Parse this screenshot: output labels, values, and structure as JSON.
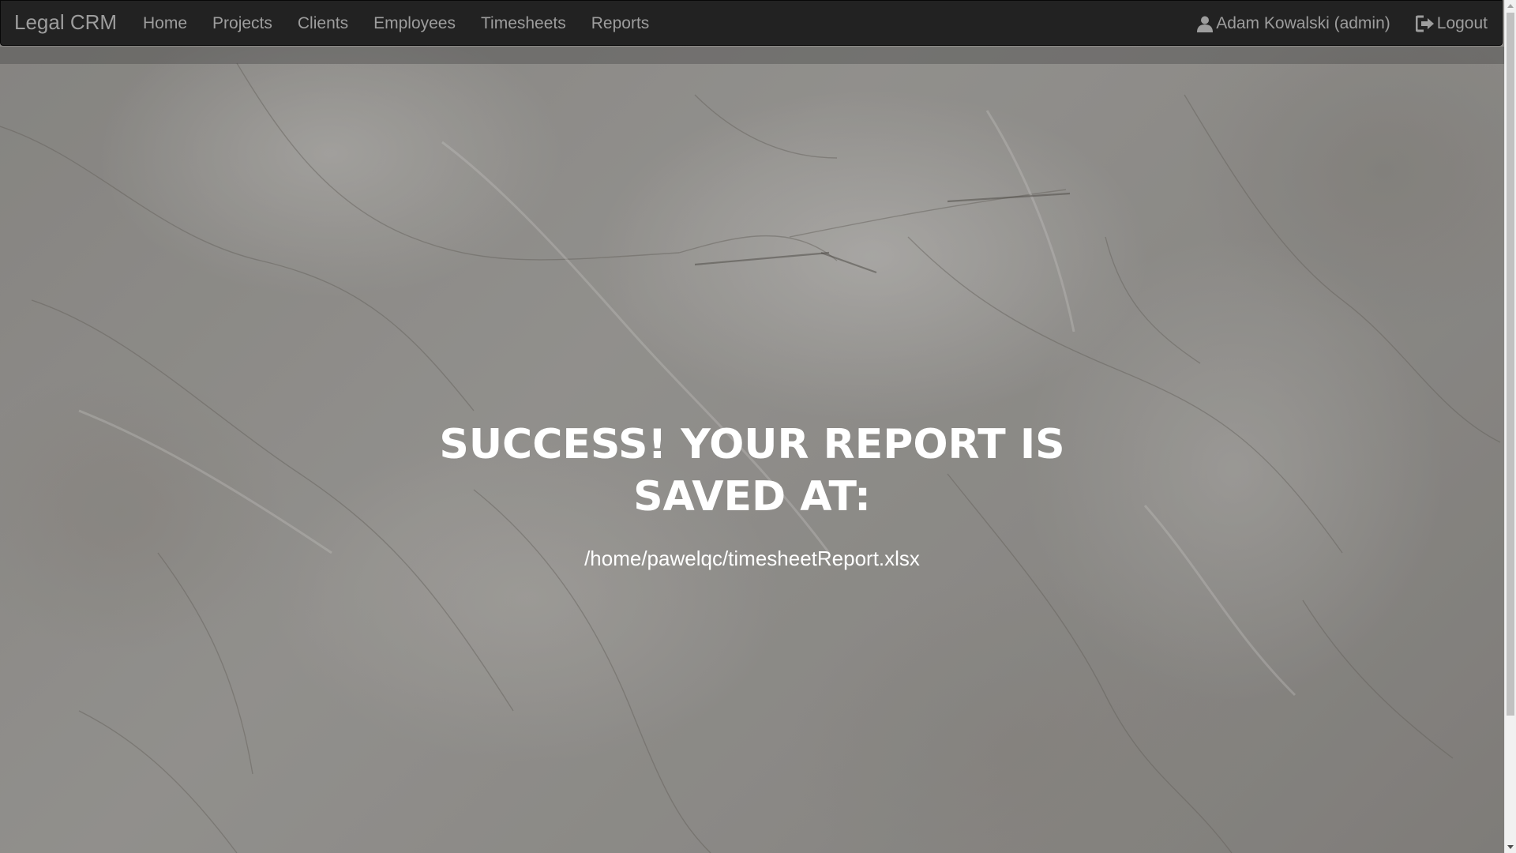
{
  "navbar": {
    "brand": "Legal CRM",
    "links": [
      {
        "label": "Home"
      },
      {
        "label": "Projects"
      },
      {
        "label": "Clients"
      },
      {
        "label": "Employees"
      },
      {
        "label": "Timesheets"
      },
      {
        "label": "Reports"
      }
    ],
    "user": {
      "label": "Adam Kowalski (admin)",
      "icon": "user-icon"
    },
    "logout": {
      "label": "Logout",
      "icon": "logout-icon"
    }
  },
  "main": {
    "heading": "SUCCESS! YOUR REPORT IS SAVED AT:",
    "file_path": "/home/pawelqc/timesheetReport.xlsx"
  },
  "colors": {
    "navbar_bg": "#222222",
    "navbar_text": "#9d9d9d",
    "heading_text": "#ffffff"
  }
}
